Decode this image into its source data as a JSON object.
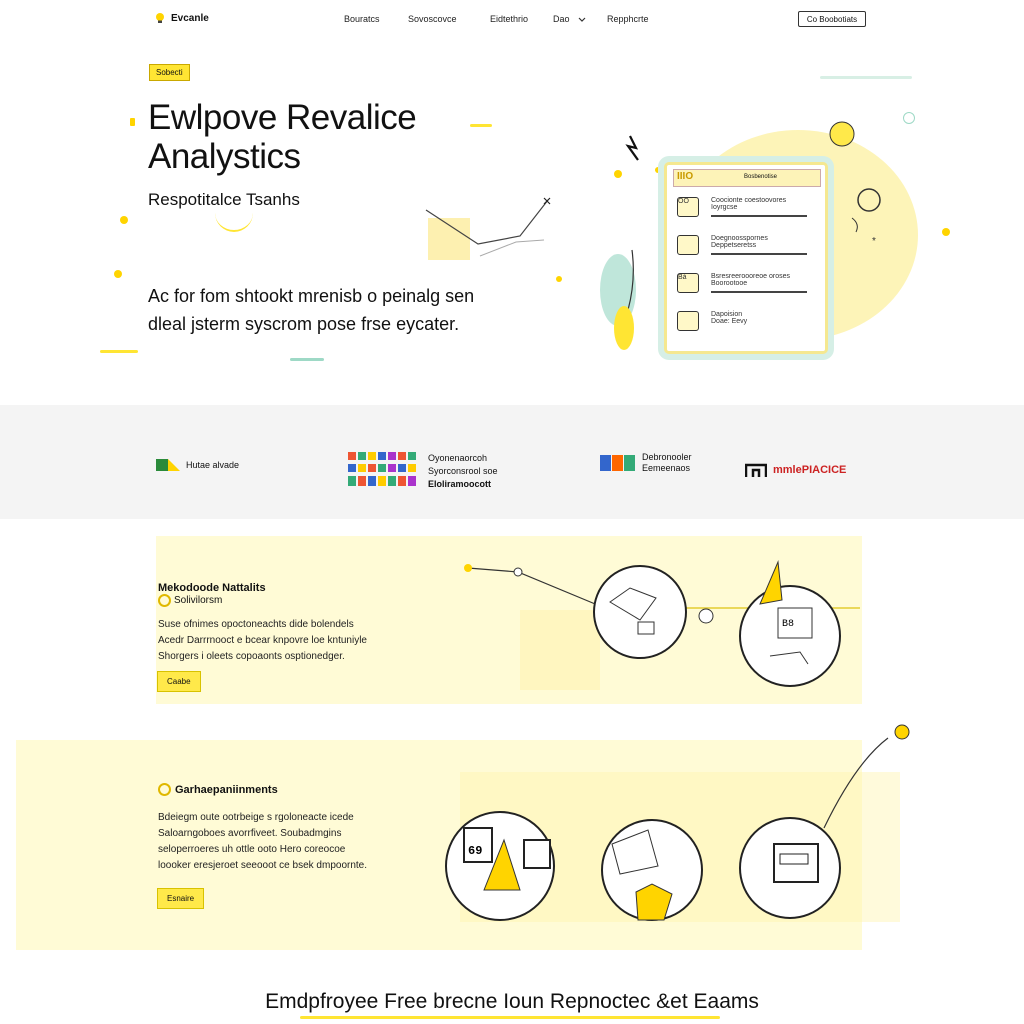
{
  "nav": {
    "logo_text": "Evcanle",
    "links": [
      "Bouratcs",
      "Sovoscovce",
      "Eidtethrio",
      "Dao",
      "Repphcrte"
    ],
    "cta_label": "Co Boobotiats",
    "icons": {
      "logo": "lightbulb-icon",
      "dropdown": "chevron-down-icon"
    }
  },
  "hero": {
    "badge": "Sobecti",
    "title_line1": "Ewlpove Revalice",
    "title_line2": "Analystics",
    "subtitle": "Respotitalce Tsanhs",
    "body_line1": "Ac for fom shtookt mrenisb o peinalg sen",
    "body_line2": "dleal jsterm syscrom pose frse eycater."
  },
  "illustration": {
    "header_label": "IIIO",
    "header_right": "Bosbenotise",
    "rows": [
      {
        "icon_text": "OO",
        "line1": "Coocionte coestoovores",
        "line2": "Ioyrgcse"
      },
      {
        "icon_text": "",
        "line1": "Doegnoosspornes",
        "line2": "Deppetseretss"
      },
      {
        "icon_text": "Bå",
        "line1": "Bsresreeroooreoe oroses",
        "line2": "Boorootooe"
      },
      {
        "icon_text": "",
        "line1": "Dapoision",
        "line2": "Doae: Eevy"
      }
    ]
  },
  "partners": [
    {
      "name": "Hutae alvade",
      "sub": ""
    },
    {
      "name": "Oyonenaorcoh",
      "sub": "Syorconsrool soe"
    },
    {
      "name": "Debronooler",
      "sub": "Eemeenaos"
    },
    {
      "name": "mmlePIACICE",
      "sub": ""
    }
  ],
  "partner_extra": "Eloliramoocott",
  "feature1": {
    "title": "Mekodoode Nattalits",
    "title2": "Solivilorsm",
    "body_line1": "Suse ofnimes opoctoneachts dide bolendels",
    "body_line2": "Acedr Darrrnooct e bcear knpovre loe kntuniyle",
    "body_line3": "Shorgers i oleets copoaonts osptionedger.",
    "button": "Caabe"
  },
  "feature2": {
    "title": "Garhaepaniinments",
    "body_line1": "Bdeiegm oute ootrbeige s rgoloneacte icede",
    "body_line2": "Saloarngoboes avorrfiveet. Soubadmgins",
    "body_line3": "seloperroeres uh ottle ooto Hero coreocoe",
    "body_line4": "loooker eresjeroet seeooot ce bsek dmpoornte.",
    "button": "Esnaire"
  },
  "bottom": {
    "title": "Emdpfroyee Free brecne Ioun Repnoctec &et Eaams"
  },
  "colors": {
    "accent": "#ffe533",
    "mint": "#b8e3d3",
    "feature_bg": "#fffbd6",
    "band_bg": "#f4f4f4"
  }
}
